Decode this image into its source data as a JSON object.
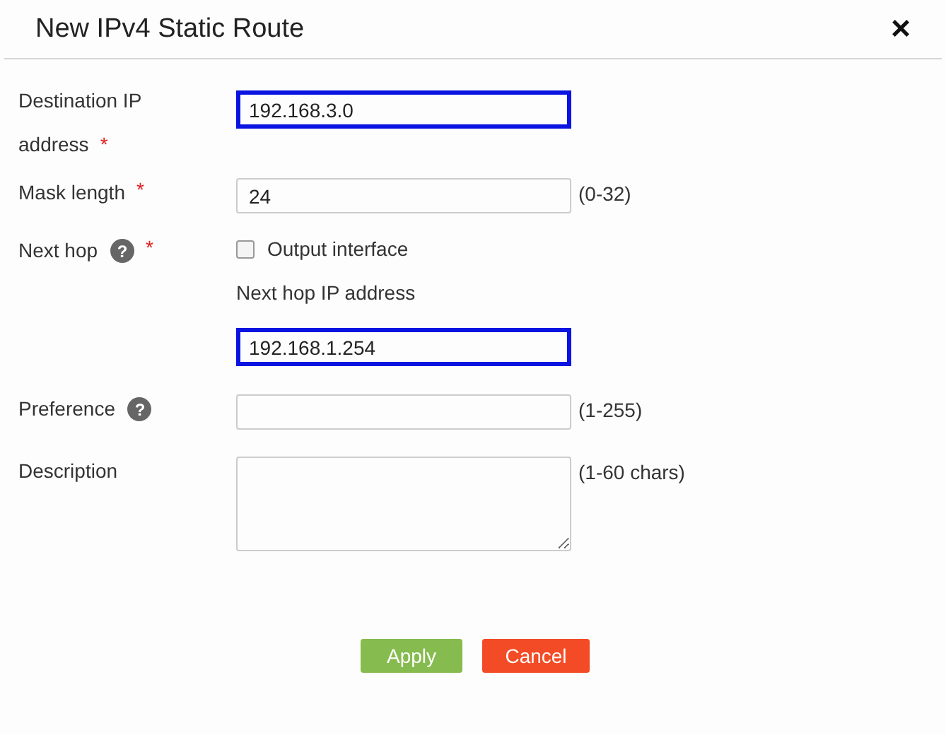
{
  "dialog": {
    "title": "New IPv4 Static Route",
    "close": "×"
  },
  "rows": [
    {
      "kind": "input",
      "label": "Destination IP address",
      "required": "*",
      "value": "192.168.3.0",
      "focused": true
    },
    {
      "kind": "input",
      "label": "Mask length",
      "required": "*",
      "value": "24",
      "hint": "(0-32)",
      "focused": false
    },
    {
      "kind": "nexthop",
      "label": "Next hop",
      "help": "?",
      "required": "*",
      "option": {
        "label": "Output interface",
        "checked": false
      },
      "sublabel": "Next hop IP address",
      "value": "192.168.1.254",
      "focused": true
    },
    {
      "kind": "input",
      "label": "Preference",
      "help": "?",
      "hint": "(1-255)",
      "focused": false
    },
    {
      "kind": "textarea",
      "label": "Description",
      "hint": "(1-60 chars)",
      "focused": false
    }
  ],
  "buttons": [
    {
      "label": "Apply",
      "kind": "primary"
    },
    {
      "label": "Cancel",
      "kind": "danger"
    }
  ]
}
